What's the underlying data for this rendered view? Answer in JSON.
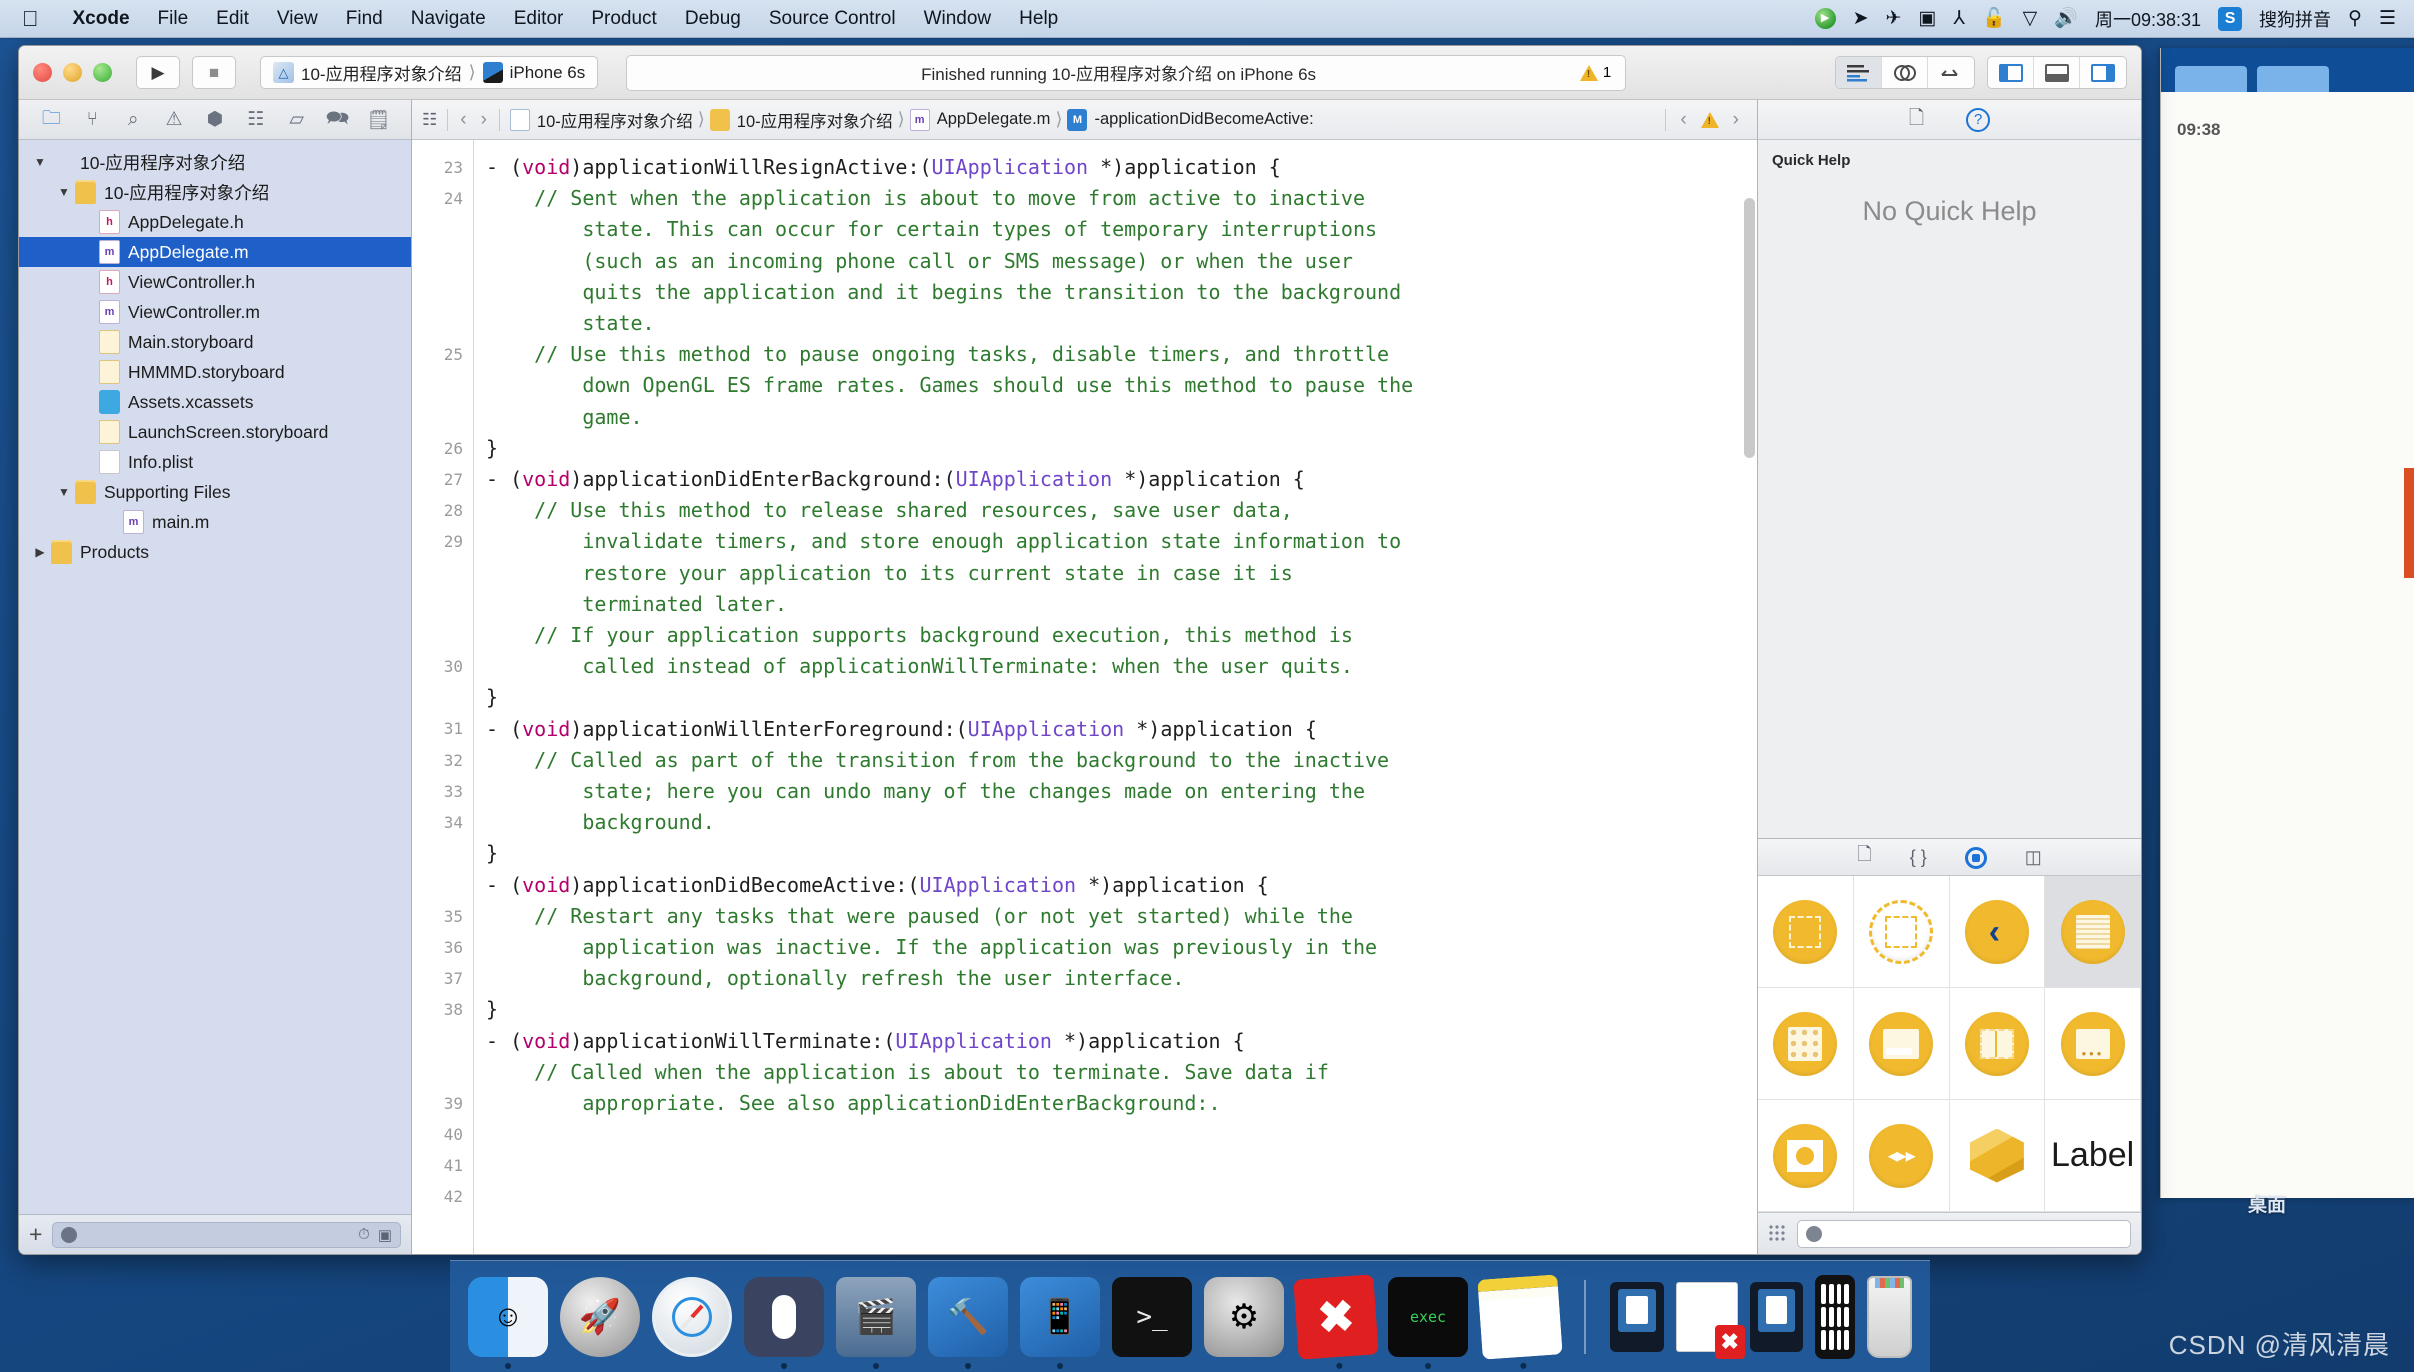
{
  "menubar": {
    "apple_icon": "apple-icon",
    "items": [
      {
        "label": "Xcode",
        "bold": true
      },
      {
        "label": "File",
        "bold": false
      },
      {
        "label": "Edit",
        "bold": false
      },
      {
        "label": "View",
        "bold": false
      },
      {
        "label": "Find",
        "bold": false
      },
      {
        "label": "Navigate",
        "bold": false
      },
      {
        "label": "Editor",
        "bold": false
      },
      {
        "label": "Product",
        "bold": false
      },
      {
        "label": "Debug",
        "bold": false
      },
      {
        "label": "Source Control",
        "bold": false
      },
      {
        "label": "Window",
        "bold": false
      },
      {
        "label": "Help",
        "bold": false
      }
    ],
    "status_icons": [
      {
        "name": "screen-share-icon",
        "glyph": "▶"
      },
      {
        "name": "location-arrow-icon",
        "glyph": "➤"
      },
      {
        "name": "airplane-icon",
        "glyph": "✈"
      },
      {
        "name": "screen-record-icon",
        "glyph": "▣"
      },
      {
        "name": "bluetooth-icon",
        "glyph": "⅄"
      },
      {
        "name": "lock-icon",
        "glyph": "🔓"
      },
      {
        "name": "wifi-icon",
        "glyph": "▽"
      },
      {
        "name": "volume-icon",
        "glyph": "🔊"
      }
    ],
    "clock": "周一09:38:31",
    "input_method_badge": "S",
    "input_method": "搜狗拼音",
    "search_icon": "search-icon",
    "list_icon": "control-center-icon"
  },
  "toolbar": {
    "run_label": "▶",
    "stop_label": "■",
    "scheme": "10-应用程序对象介绍",
    "scheme_separator": "⟩",
    "destination": "iPhone 6s",
    "status_text": "Finished running 10-应用程序对象介绍 on iPhone 6s",
    "warning_count": "1",
    "editor_modes": [
      "standard-editor",
      "assistant-editor",
      "version-editor"
    ],
    "panel_toggles": [
      "navigator-toggle",
      "debug-area-toggle",
      "utilities-toggle"
    ]
  },
  "navigator": {
    "tabs": [
      {
        "name": "project-navigator",
        "glyph": "🗀",
        "active": true
      },
      {
        "name": "source-control-navigator",
        "glyph": "⑂",
        "active": false
      },
      {
        "name": "symbol-navigator",
        "glyph": "⌕",
        "active": false
      },
      {
        "name": "find-navigator",
        "glyph": "⚠",
        "active": false
      },
      {
        "name": "issue-navigator",
        "glyph": "⬢",
        "active": false
      },
      {
        "name": "test-navigator",
        "glyph": "☷",
        "active": false
      },
      {
        "name": "debug-navigator",
        "glyph": "▱",
        "active": false
      },
      {
        "name": "breakpoint-navigator",
        "glyph": "🗪",
        "active": false
      },
      {
        "name": "report-navigator",
        "glyph": "🗒",
        "active": false
      }
    ],
    "tree": [
      {
        "label": "10-应用程序对象介绍",
        "indent": 0,
        "twisty": "▼",
        "icon": "project",
        "selected": false
      },
      {
        "label": "10-应用程序对象介绍",
        "indent": 1,
        "twisty": "▼",
        "icon": "folder",
        "selected": false
      },
      {
        "label": "AppDelegate.h",
        "indent": 2,
        "twisty": "",
        "icon": "h",
        "selected": false
      },
      {
        "label": "AppDelegate.m",
        "indent": 2,
        "twisty": "",
        "icon": "m",
        "selected": true
      },
      {
        "label": "ViewController.h",
        "indent": 2,
        "twisty": "",
        "icon": "h",
        "selected": false
      },
      {
        "label": "ViewController.m",
        "indent": 2,
        "twisty": "",
        "icon": "m",
        "selected": false
      },
      {
        "label": "Main.storyboard",
        "indent": 2,
        "twisty": "",
        "icon": "sb",
        "selected": false
      },
      {
        "label": "HMMMD.storyboard",
        "indent": 2,
        "twisty": "",
        "icon": "sb",
        "selected": false
      },
      {
        "label": "Assets.xcassets",
        "indent": 2,
        "twisty": "",
        "icon": "xcassets",
        "selected": false
      },
      {
        "label": "LaunchScreen.storyboard",
        "indent": 2,
        "twisty": "",
        "icon": "sb",
        "selected": false
      },
      {
        "label": "Info.plist",
        "indent": 2,
        "twisty": "",
        "icon": "plist",
        "selected": false
      },
      {
        "label": "Supporting Files",
        "indent": 1,
        "twisty": "▼",
        "icon": "folder",
        "selected": false
      },
      {
        "label": "main.m",
        "indent": 3,
        "twisty": "",
        "icon": "m",
        "selected": false
      },
      {
        "label": "Products",
        "indent": 0,
        "twisty": "▶",
        "icon": "folder",
        "selected": false
      }
    ],
    "add_button": "+",
    "filter_placeholder": "",
    "filter_icons": [
      "recent-filter-icon",
      "source-filter-icon"
    ]
  },
  "jumpbar": {
    "related_icon": "related-items-icon",
    "back": "‹",
    "forward": "›",
    "crumbs": [
      {
        "label": "10-应用程序对象介绍",
        "icon": "proj"
      },
      {
        "label": "10-应用程序对象介绍",
        "icon": "fold"
      },
      {
        "label": "AppDelegate.m",
        "icon": "m"
      },
      {
        "label": "-applicationDidBecomeActive:",
        "icon": "M"
      }
    ],
    "prev_issue": "‹",
    "next_issue": "›",
    "warning_icon": "warning-triangle-icon"
  },
  "editor": {
    "line_numbers": [
      "23",
      "24",
      "",
      "",
      "",
      "",
      "25",
      "",
      "",
      "26",
      "27",
      "28",
      "29",
      "",
      "",
      "",
      "30",
      "",
      "31",
      "32",
      "33",
      "34",
      "",
      "",
      "35",
      "36",
      "37",
      "38",
      "",
      "",
      "39",
      "40",
      "41",
      "42",
      ""
    ],
    "lines": [
      {
        "n": "23",
        "segs": [
          {
            "t": "- (",
            "c": ""
          },
          {
            "t": "void",
            "c": "kw"
          },
          {
            "t": ")applicationWillResignActive:(",
            "c": ""
          },
          {
            "t": "UIApplication",
            "c": "cls"
          },
          {
            "t": " *)application {",
            "c": ""
          }
        ]
      },
      {
        "n": "24",
        "segs": [
          {
            "t": "    // Sent when the application is about to move from active to inactive",
            "c": "cmt"
          }
        ]
      },
      {
        "n": "",
        "segs": [
          {
            "t": "        state. This can occur for certain types of temporary interruptions",
            "c": "cmt"
          }
        ]
      },
      {
        "n": "",
        "segs": [
          {
            "t": "        (such as an incoming phone call or SMS message) or when the user",
            "c": "cmt"
          }
        ]
      },
      {
        "n": "",
        "segs": [
          {
            "t": "        quits the application and it begins the transition to the background",
            "c": "cmt"
          }
        ]
      },
      {
        "n": "",
        "segs": [
          {
            "t": "        state.",
            "c": "cmt"
          }
        ]
      },
      {
        "n": "25",
        "segs": [
          {
            "t": "    // Use this method to pause ongoing tasks, disable timers, and throttle",
            "c": "cmt"
          }
        ]
      },
      {
        "n": "",
        "segs": [
          {
            "t": "        down OpenGL ES frame rates. Games should use this method to pause the",
            "c": "cmt"
          }
        ]
      },
      {
        "n": "",
        "segs": [
          {
            "t": "        game.",
            "c": "cmt"
          }
        ]
      },
      {
        "n": "26",
        "segs": [
          {
            "t": "}",
            "c": ""
          }
        ]
      },
      {
        "n": "27",
        "segs": [
          {
            "t": "",
            "c": ""
          }
        ]
      },
      {
        "n": "28",
        "segs": [
          {
            "t": "- (",
            "c": ""
          },
          {
            "t": "void",
            "c": "kw"
          },
          {
            "t": ")applicationDidEnterBackground:(",
            "c": ""
          },
          {
            "t": "UIApplication",
            "c": "cls"
          },
          {
            "t": " *)application {",
            "c": ""
          }
        ]
      },
      {
        "n": "29",
        "segs": [
          {
            "t": "    // Use this method to release shared resources, save user data,",
            "c": "cmt"
          }
        ]
      },
      {
        "n": "",
        "segs": [
          {
            "t": "        invalidate timers, and store enough application state information to",
            "c": "cmt"
          }
        ]
      },
      {
        "n": "",
        "segs": [
          {
            "t": "        restore your application to its current state in case it is",
            "c": "cmt"
          }
        ]
      },
      {
        "n": "",
        "segs": [
          {
            "t": "        terminated later.",
            "c": "cmt"
          }
        ]
      },
      {
        "n": "30",
        "segs": [
          {
            "t": "    // If your application supports background execution, this method is",
            "c": "cmt"
          }
        ]
      },
      {
        "n": "",
        "segs": [
          {
            "t": "        called instead of applicationWillTerminate: when the user quits.",
            "c": "cmt"
          }
        ]
      },
      {
        "n": "31",
        "segs": [
          {
            "t": "}",
            "c": ""
          }
        ]
      },
      {
        "n": "32",
        "segs": [
          {
            "t": "",
            "c": ""
          }
        ]
      },
      {
        "n": "33",
        "segs": [
          {
            "t": "- (",
            "c": ""
          },
          {
            "t": "void",
            "c": "kw"
          },
          {
            "t": ")applicationWillEnterForeground:(",
            "c": ""
          },
          {
            "t": "UIApplication",
            "c": "cls"
          },
          {
            "t": " *)application {",
            "c": ""
          }
        ]
      },
      {
        "n": "34",
        "segs": [
          {
            "t": "    // Called as part of the transition from the background to the inactive",
            "c": "cmt"
          }
        ]
      },
      {
        "n": "",
        "segs": [
          {
            "t": "        state; here you can undo many of the changes made on entering the",
            "c": "cmt"
          }
        ]
      },
      {
        "n": "",
        "segs": [
          {
            "t": "        background.",
            "c": "cmt"
          }
        ]
      },
      {
        "n": "35",
        "segs": [
          {
            "t": "}",
            "c": ""
          }
        ]
      },
      {
        "n": "36",
        "segs": [
          {
            "t": "",
            "c": ""
          }
        ]
      },
      {
        "n": "37",
        "segs": [
          {
            "t": "- (",
            "c": ""
          },
          {
            "t": "void",
            "c": "kw"
          },
          {
            "t": ")applicationDidBecomeActive:(",
            "c": ""
          },
          {
            "t": "UIApplication",
            "c": "cls"
          },
          {
            "t": " *)application {",
            "c": ""
          }
        ]
      },
      {
        "n": "38",
        "segs": [
          {
            "t": "    // Restart any tasks that were paused (or not yet started) while the",
            "c": "cmt"
          }
        ]
      },
      {
        "n": "",
        "segs": [
          {
            "t": "        application was inactive. If the application was previously in the",
            "c": "cmt"
          }
        ]
      },
      {
        "n": "",
        "segs": [
          {
            "t": "        background, optionally refresh the user interface.",
            "c": "cmt"
          }
        ]
      },
      {
        "n": "39",
        "segs": [
          {
            "t": "}",
            "c": ""
          }
        ]
      },
      {
        "n": "40",
        "segs": [
          {
            "t": "",
            "c": ""
          }
        ]
      },
      {
        "n": "41",
        "segs": [
          {
            "t": "- (",
            "c": ""
          },
          {
            "t": "void",
            "c": "kw"
          },
          {
            "t": ")applicationWillTerminate:(",
            "c": ""
          },
          {
            "t": "UIApplication",
            "c": "cls"
          },
          {
            "t": " *)application {",
            "c": ""
          }
        ]
      },
      {
        "n": "42",
        "segs": [
          {
            "t": "    // Called when the application is about to terminate. Save data if",
            "c": "cmt"
          }
        ]
      },
      {
        "n": "",
        "segs": [
          {
            "t": "        appropriate. See also applicationDidEnterBackground:.",
            "c": "cmt"
          }
        ]
      }
    ]
  },
  "utility": {
    "tabs": [
      {
        "name": "file-inspector",
        "glyph": "🗋",
        "active": false
      },
      {
        "name": "quick-help-inspector",
        "glyph": "?",
        "active": true
      }
    ],
    "quick_help_title": "Quick Help",
    "quick_help_empty": "No Quick Help",
    "library_tabs": [
      {
        "name": "file-template-library",
        "glyph": "🗋",
        "active": false
      },
      {
        "name": "code-snippet-library",
        "glyph": "{ }",
        "active": false
      },
      {
        "name": "object-library",
        "glyph": "◎",
        "active": true
      },
      {
        "name": "media-library",
        "glyph": "◫",
        "active": false
      }
    ],
    "library_items": [
      {
        "name": "view-controller-object",
        "kind": "dashed-square",
        "selected": false
      },
      {
        "name": "storyboard-reference-object",
        "kind": "dashed-circle",
        "selected": false
      },
      {
        "name": "navigation-controller-object",
        "kind": "chevron",
        "selected": false
      },
      {
        "name": "table-view-controller-object",
        "kind": "lines",
        "selected": true
      },
      {
        "name": "collection-view-controller-object",
        "kind": "dots",
        "selected": false
      },
      {
        "name": "tab-bar-controller-object",
        "kind": "panel",
        "selected": false
      },
      {
        "name": "split-view-controller-object",
        "kind": "split",
        "selected": false
      },
      {
        "name": "page-view-controller-object",
        "kind": "toolbar",
        "selected": false
      },
      {
        "name": "image-view-controller-object",
        "kind": "image",
        "selected": false
      },
      {
        "name": "avplayer-controller-object",
        "kind": "player",
        "selected": false
      },
      {
        "name": "object-cube",
        "kind": "cube",
        "selected": false
      },
      {
        "name": "label-object",
        "kind": "label",
        "label": "Label",
        "selected": false
      }
    ],
    "library_filter_placeholder": ""
  },
  "dock": {
    "items": [
      {
        "name": "finder-app",
        "running": true
      },
      {
        "name": "launchpad-app",
        "running": false
      },
      {
        "name": "safari-app",
        "running": false
      },
      {
        "name": "mouse-app",
        "running": true
      },
      {
        "name": "quicktime-app",
        "running": true
      },
      {
        "name": "xcode-app",
        "running": true
      },
      {
        "name": "xcode-simulator-app",
        "running": true
      },
      {
        "name": "terminal-app",
        "running": false
      },
      {
        "name": "system-preferences-app",
        "running": false
      },
      {
        "name": "xmind-app",
        "running": true
      },
      {
        "name": "exec-app",
        "running": true
      },
      {
        "name": "notes-app",
        "running": true
      }
    ],
    "minimized": [
      {
        "name": "minimized-window-1"
      },
      {
        "name": "minimized-document-xmind"
      },
      {
        "name": "minimized-window-2"
      },
      {
        "name": "minimized-phone-window"
      }
    ],
    "trash": {
      "name": "trash-can"
    }
  },
  "desktop": {
    "label": "桌面",
    "watermark": "CSDN @清风清晨",
    "background_window_time": "09:38"
  }
}
